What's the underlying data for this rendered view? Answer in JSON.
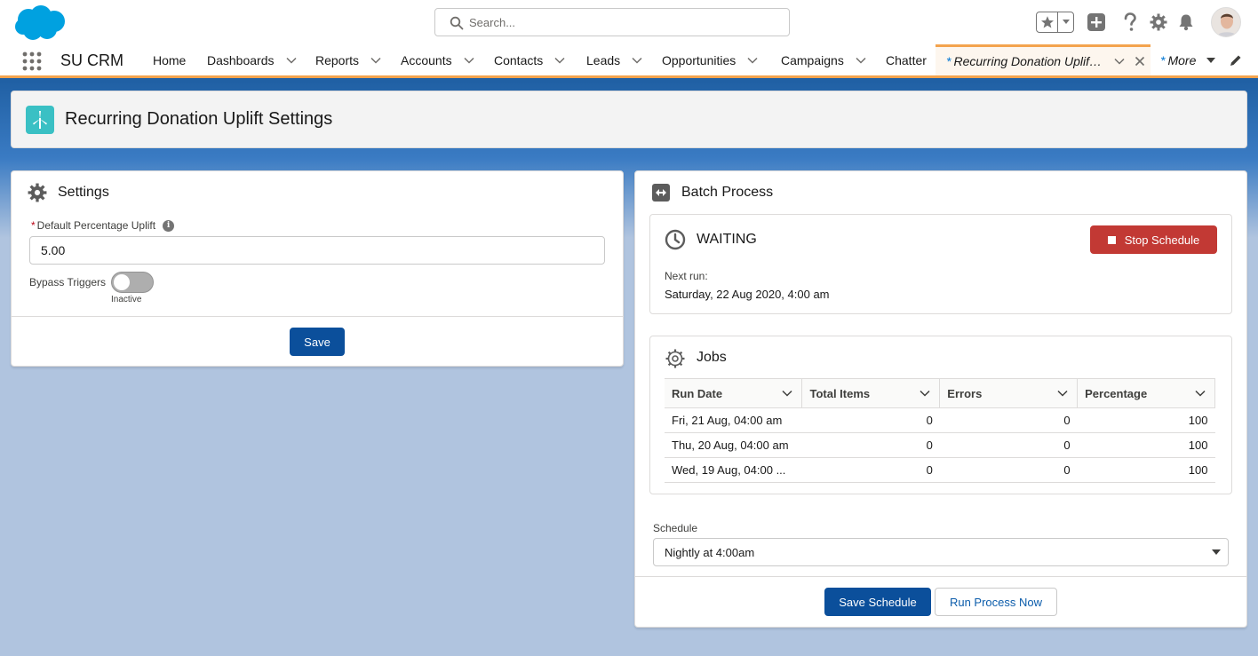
{
  "header": {
    "search_placeholder": "Search..."
  },
  "nav": {
    "app_name": "SU CRM",
    "items": [
      {
        "label": "Home"
      },
      {
        "label": "Dashboards"
      },
      {
        "label": "Reports"
      },
      {
        "label": "Accounts"
      },
      {
        "label": "Contacts"
      },
      {
        "label": "Leads"
      },
      {
        "label": "Opportunities"
      },
      {
        "label": "Campaigns"
      },
      {
        "label": "Chatter"
      }
    ],
    "active_tab": {
      "asterisk": "*",
      "label": "Recurring Donation Uplift Settings"
    },
    "more": {
      "asterisk": "*",
      "label": "More"
    }
  },
  "page": {
    "title": "Recurring Donation Uplift Settings"
  },
  "settings": {
    "title": "Settings",
    "percentage_label": "Default Percentage Uplift",
    "required_marker": "*",
    "percentage_value": "5.00",
    "bypass_label": "Bypass Triggers",
    "bypass_state": "Inactive",
    "save_label": "Save"
  },
  "batch": {
    "title": "Batch Process",
    "status": "WAITING",
    "stop_label": "Stop Schedule",
    "next_run_label": "Next run:",
    "next_run_value": "Saturday, 22 Aug 2020, 4:00 am",
    "jobs_title": "Jobs",
    "columns": [
      "Run Date",
      "Total Items",
      "Errors",
      "Percentage"
    ],
    "rows": [
      {
        "run_date": "Fri, 21 Aug, 04:00 am",
        "total_items": "0",
        "errors": "0",
        "percentage": "100"
      },
      {
        "run_date": "Thu, 20 Aug, 04:00 am",
        "total_items": "0",
        "errors": "0",
        "percentage": "100"
      },
      {
        "run_date": "Wed, 19 Aug, 04:00 ...",
        "total_items": "0",
        "errors": "0",
        "percentage": "100"
      }
    ],
    "schedule_label": "Schedule",
    "schedule_value": "Nightly at 4:00am",
    "save_schedule_label": "Save Schedule",
    "run_now_label": "Run Process Now"
  },
  "colors": {
    "brand": "#0b4f9b",
    "destructive": "#c23934",
    "tab_accent": "#f3a34d",
    "page_icon": "#3ac0c4"
  }
}
